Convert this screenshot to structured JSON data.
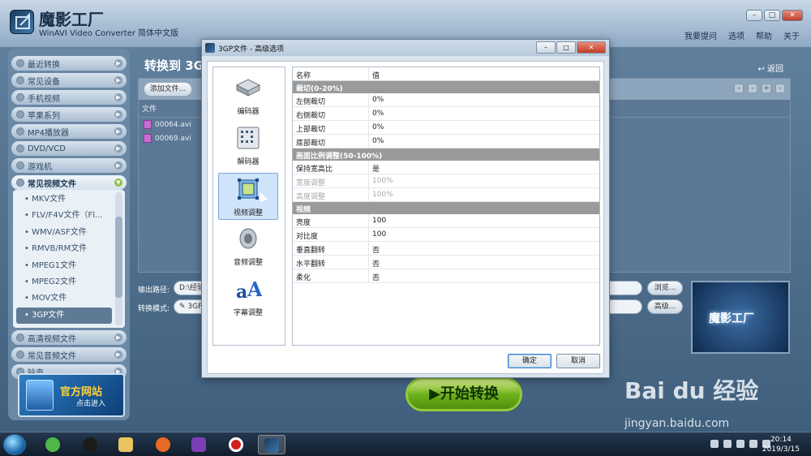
{
  "app": {
    "name": "魔影工厂",
    "subtitle": "WinAVI Video Converter 简体中文版",
    "menu": [
      "我要提问",
      "选项",
      "帮助",
      "关于"
    ]
  },
  "sidebar": {
    "categories_top": [
      "最近转换",
      "常见设备",
      "手机视频",
      "苹果系列",
      "MP4播放器",
      "DVD/VCD",
      "游戏机"
    ],
    "open_category": "常见视频文件",
    "sub_items": [
      "MKV文件",
      "FLV/F4V文件（Fl...",
      "WMV/ASF文件",
      "RMVB/RM文件",
      "MPEG1文件",
      "MPEG2文件",
      "MOV文件",
      "3GP文件"
    ],
    "selected_sub": "3GP文件",
    "categories_bottom": [
      "高清视频文件",
      "常见音频文件",
      "铃声"
    ],
    "promo_title": "官方网站",
    "promo_sub": "点击进入"
  },
  "main": {
    "title": "转换到 3G",
    "back_label": "返回",
    "add_file_label": "添加文件...",
    "file_col_header": "文件",
    "files": [
      "00064.avi",
      "00069.avi"
    ],
    "output_path_label": "输出路径:",
    "output_path_value": "D:\\经验",
    "convert_mode_label": "转换模式:",
    "convert_mode_value": "3GP",
    "browse_label": "浏览...",
    "advanced_label": "高级...",
    "preview_logo": "魔影工厂",
    "start_label": "开始转换"
  },
  "dialog": {
    "title": "3GP文件 - 高级选项",
    "nav": [
      {
        "label": "编码器",
        "icon": "encoder-icon"
      },
      {
        "label": "解码器",
        "icon": "decoder-icon"
      },
      {
        "label": "视频调整",
        "icon": "video-adjust-icon"
      },
      {
        "label": "音频调整",
        "icon": "audio-adjust-icon"
      },
      {
        "label": "字幕调整",
        "icon": "subtitle-adjust-icon"
      }
    ],
    "selected_nav": "视频调整",
    "col_name": "名称",
    "col_value": "值",
    "sections": [
      {
        "title": "裁切(0-20%)",
        "rows": [
          [
            "左侧裁切",
            "0%"
          ],
          [
            "右侧裁切",
            "0%"
          ],
          [
            "上部裁切",
            "0%"
          ],
          [
            "底部裁切",
            "0%"
          ]
        ]
      },
      {
        "title": "画面比例调整(50-100%)",
        "rows": [
          [
            "保持宽高比",
            "是"
          ],
          [
            "宽度调整",
            "100%"
          ],
          [
            "高度调整",
            "100%"
          ]
        ]
      },
      {
        "title": "视频",
        "rows": [
          [
            "亮度",
            "100"
          ],
          [
            "对比度",
            "100"
          ],
          [
            "垂直翻转",
            "否"
          ],
          [
            "水平翻转",
            "否"
          ],
          [
            "柔化",
            "否"
          ]
        ]
      }
    ],
    "ok_label": "确定",
    "cancel_label": "取消"
  },
  "watermark": {
    "brand": "Bai du 经验",
    "url": "jingyan.baidu.com"
  },
  "taskbar": {
    "time": "20:14",
    "date": "2019/3/15"
  }
}
